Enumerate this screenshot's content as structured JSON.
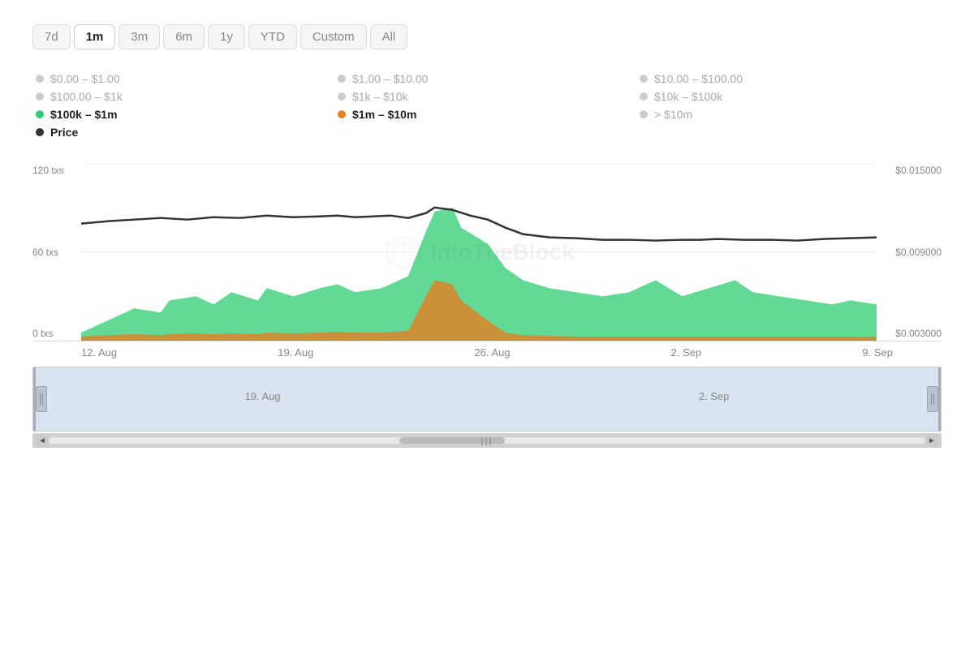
{
  "timeRange": {
    "buttons": [
      {
        "id": "7d",
        "label": "7d",
        "active": false
      },
      {
        "id": "1m",
        "label": "1m",
        "active": true
      },
      {
        "id": "3m",
        "label": "3m",
        "active": false
      },
      {
        "id": "6m",
        "label": "6m",
        "active": false
      },
      {
        "id": "1y",
        "label": "1y",
        "active": false
      },
      {
        "id": "ytd",
        "label": "YTD",
        "active": false
      },
      {
        "id": "custom",
        "label": "Custom",
        "active": false
      },
      {
        "id": "all",
        "label": "All",
        "active": false
      }
    ]
  },
  "legend": {
    "items": [
      {
        "id": "0-1",
        "label": "$0.00 – $1.00",
        "color": "gray",
        "active": false
      },
      {
        "id": "1-10",
        "label": "$1.00 – $10.00",
        "color": "gray",
        "active": false
      },
      {
        "id": "10-100",
        "label": "$10.00 – $100.00",
        "color": "gray",
        "active": false
      },
      {
        "id": "100-1k",
        "label": "$100.00 – $1k",
        "color": "gray",
        "active": false
      },
      {
        "id": "1k-10k",
        "label": "$1k – $10k",
        "color": "gray",
        "active": false
      },
      {
        "id": "10k-100k",
        "label": "$10k – $100k",
        "color": "gray",
        "active": false
      },
      {
        "id": "100k-1m",
        "label": "$100k – $1m",
        "color": "green",
        "active": true
      },
      {
        "id": "1m-10m",
        "label": "$1m – $10m",
        "color": "orange",
        "active": true
      },
      {
        "id": "gt-10m",
        "label": "> $10m",
        "color": "gray",
        "active": false
      },
      {
        "id": "price",
        "label": "Price",
        "color": "dark",
        "active": true
      }
    ]
  },
  "chart": {
    "yAxisLeft": [
      "120 txs",
      "60 txs",
      "0 txs"
    ],
    "yAxisRight": [
      "$0.015000",
      "$0.009000",
      "$0.003000"
    ],
    "xAxisLabels": [
      "12. Aug",
      "19. Aug",
      "26. Aug",
      "2. Sep",
      "9. Sep"
    ],
    "watermark": "IntoTheBlock"
  },
  "navigator": {
    "labels": [
      "19. Aug",
      "2. Sep"
    ]
  },
  "scrollbar": {
    "leftArrow": "◄",
    "rightArrow": "►",
    "middleHandle": "|||"
  }
}
